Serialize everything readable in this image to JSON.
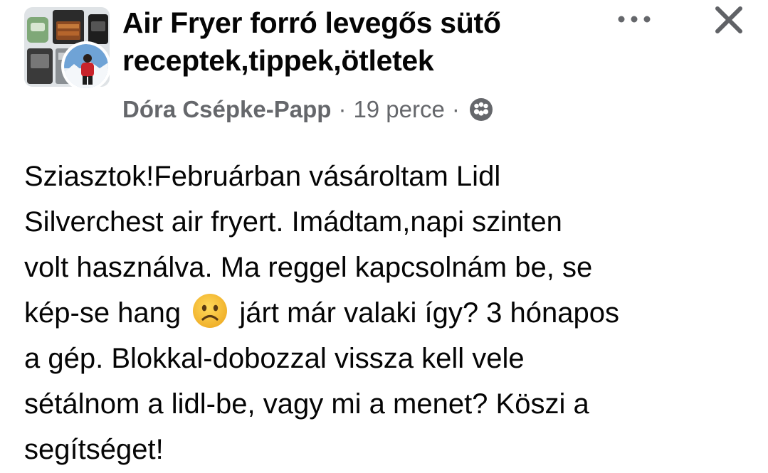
{
  "group": {
    "name": "Air Fryer forró levegős sütő receptek,tippek,ötletek",
    "thumbnail_icon": "air-fryer-group-photo",
    "avatar_icon": "user-avatar-photo"
  },
  "post_meta": {
    "author": "Dóra Csépke-Papp",
    "separator": "·",
    "time": "19 perce",
    "audience_icon": "group-members-icon"
  },
  "actions": {
    "more_label": "•••",
    "close_icon": "close-icon"
  },
  "post": {
    "text_lines": [
      "Sziasztok!Februárban vásároltam Lidl",
      "Silverchest air fryert. Imádtam,napi szinten",
      "volt használva. Ma reggel kapcsolnám be, se",
      "kép-se hang",
      "járt már valaki így? 3 hónapos",
      "a gép. Blokkal-dobozzal vissza kell vele",
      "sétálnom a lidl-be, vagy mi a menet? Köszi a",
      "segítséget!"
    ],
    "emoji_icon": "frowning-face-emoji"
  },
  "colors": {
    "primary_text": "#050505",
    "secondary_text": "#65676b",
    "background": "#ffffff",
    "emoji_yellow": "#f7c23c"
  }
}
